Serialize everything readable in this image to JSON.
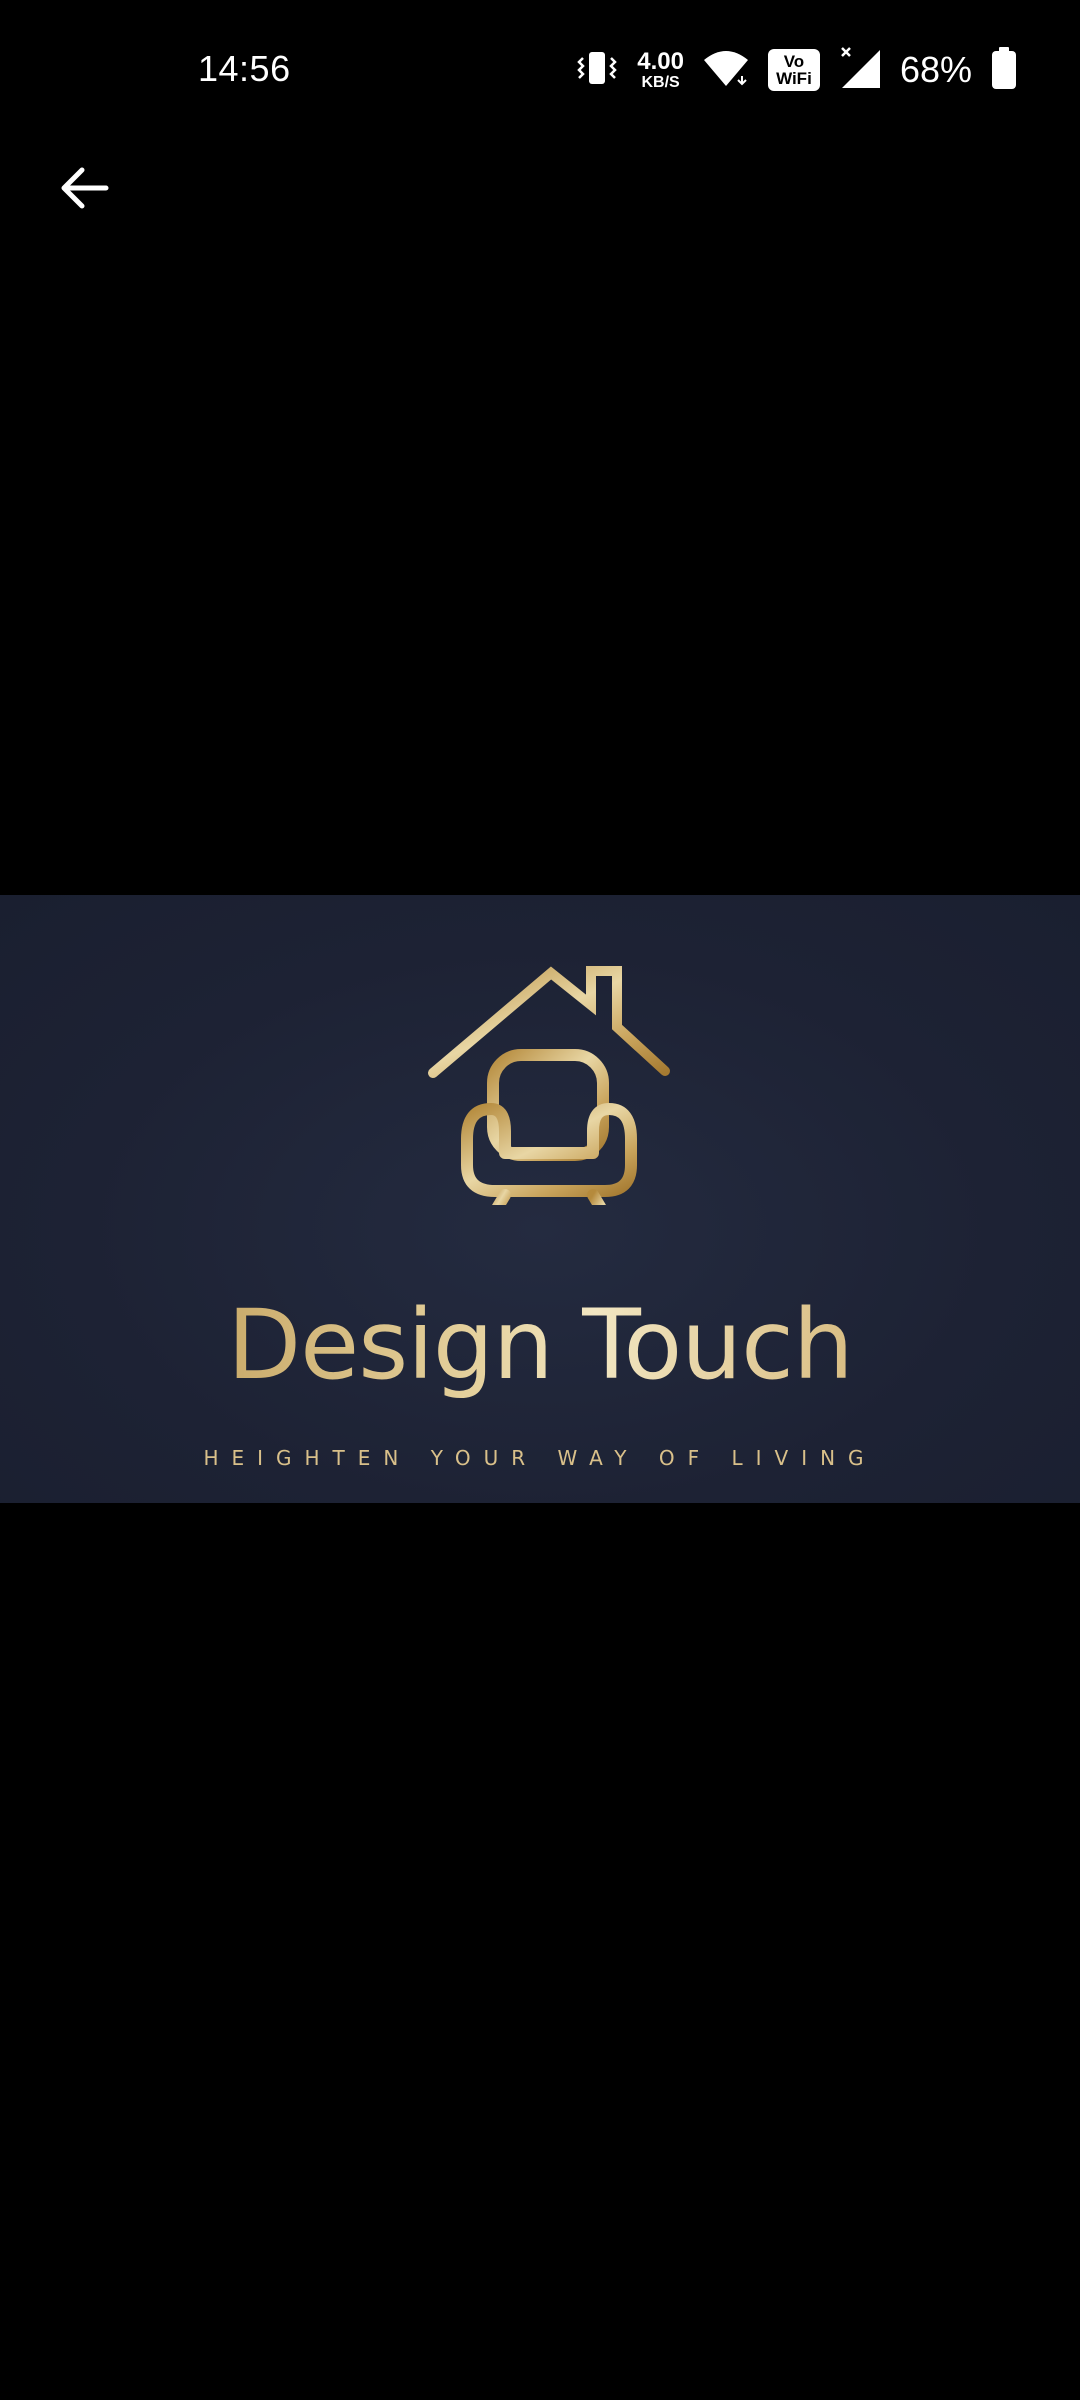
{
  "status_bar": {
    "time": "14:56",
    "net_speed_value": "4.00",
    "net_speed_unit": "KB/S",
    "vowifi_top": "Vo",
    "vowifi_bottom": "WiFi",
    "battery_percent": "68%",
    "icons": [
      "vibrate-icon",
      "wifi-icon",
      "vowifi-icon",
      "cell-signal-icon",
      "battery-icon"
    ]
  },
  "toolbar": {
    "back_icon": "arrow-left-icon"
  },
  "image": {
    "brand_name": "Design Touch",
    "tagline": "HEIGHTEN YOUR WAY OF LIVING",
    "logo_icon": "house-armchair-logo",
    "colors": {
      "banner_bg": "#1e2335",
      "gold": "#c9a45c",
      "gold_light": "#efe2bd"
    }
  }
}
